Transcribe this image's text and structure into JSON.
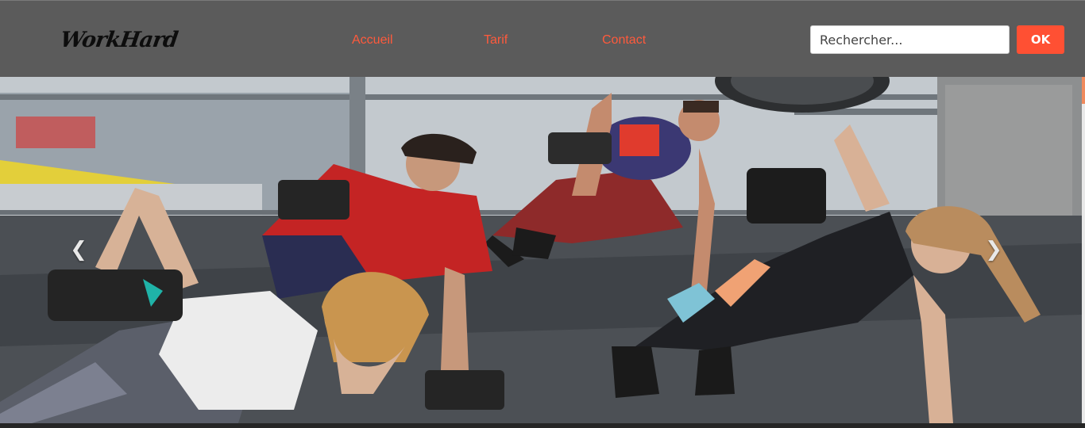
{
  "navbar": {
    "brand": "WorkHard",
    "links": [
      {
        "label": "Accueil"
      },
      {
        "label": "Tarif"
      },
      {
        "label": "Contact"
      }
    ],
    "search": {
      "placeholder": "Rechercher...",
      "value": ""
    },
    "ok_label": "OK"
  },
  "carousel": {
    "prev_icon": "chevron-left-icon",
    "next_icon": "chevron-right-icon",
    "image": "group-fitness-dumbbell-plank-photo"
  },
  "colors": {
    "navbar_bg": "#5b5b5b",
    "accent": "#ff5033",
    "link": "#ff5a3c"
  }
}
